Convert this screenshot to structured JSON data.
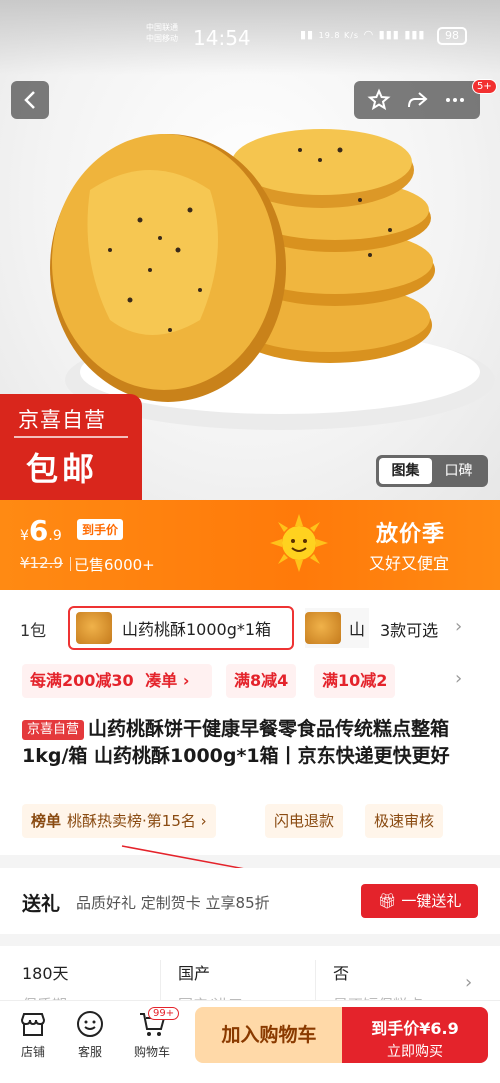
{
  "status_bar": {
    "carrier_1": "中国联通",
    "carrier_2": "中国移动",
    "time": "14:54",
    "net_speed": "19.8 K/s",
    "battery": "98"
  },
  "top_actions": {
    "more_badge": "5+"
  },
  "hero": {
    "stamp_line1": "京喜自营",
    "stamp_line2": "包邮",
    "gallery_on": "图集",
    "gallery_off": "口碑"
  },
  "price": {
    "currency": "¥",
    "value_int": "6",
    "value_dec": ".9",
    "tag": "到手价",
    "original": "¥12.9",
    "sold": "已售6000+",
    "campaign_title": "放价季",
    "campaign_sub": "又好又便宜"
  },
  "variants": {
    "prev_text": "1包",
    "selected": "山药桃酥1000g*1箱",
    "next_text": "山",
    "count": "3款可选"
  },
  "promos": [
    "每满200减30",
    "凑单",
    "满8减4",
    "满10减2"
  ],
  "product": {
    "badge": "京喜自营",
    "title": "山药桃酥饼干健康早餐零食品传统糕点整箱1kg/箱 山药桃酥1000g*1箱丨京东快递更快更好"
  },
  "tags": {
    "rank_label": "榜单",
    "rank_text": "桃酥热卖榜·第15名",
    "tag2": "闪电退款",
    "tag3": "极速审核"
  },
  "gift": {
    "title": "送礼",
    "desc": "品质好礼 定制贺卡 立享85折",
    "button": "一键送礼"
  },
  "specs": [
    {
      "value": "180天",
      "label": "保质期"
    },
    {
      "value": "国产",
      "label": "国产/进口"
    },
    {
      "value": "否",
      "label": "是否短保糕点"
    }
  ],
  "bottom_bar": {
    "shop": "店铺",
    "service": "客服",
    "cart": "购物车",
    "cart_badge": "99+",
    "add_cart": "加入购物车",
    "buy_line1": "到手价¥6.9",
    "buy_line2": "立即购买"
  },
  "colors": {
    "accent_red": "#e4232b",
    "banner_orange": "#ff7a0a"
  }
}
